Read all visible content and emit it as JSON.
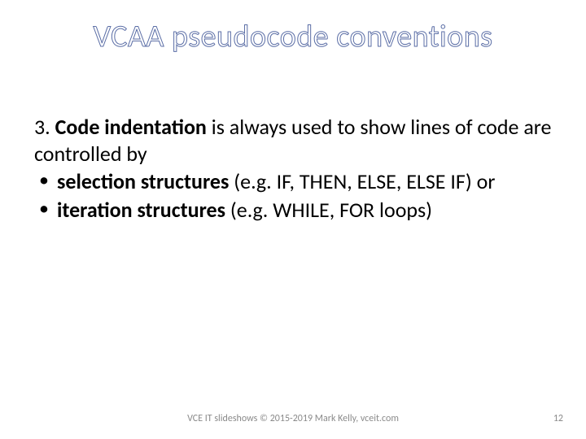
{
  "title": "VCAA pseudocode conventions",
  "intro_num": "3. ",
  "intro_bold": "Code indentation",
  "intro_rest": " is always used to show lines of code are controlled by",
  "bullets": [
    {
      "bold": "selection structures",
      "rest": " (e.g. IF, THEN, ELSE, ELSE IF) or"
    },
    {
      "bold": "iteration structures",
      "rest": " (e.g. WHILE, FOR loops)"
    }
  ],
  "footer": "VCE IT slideshows © 2015-2019 Mark Kelly, vceit.com",
  "page": "12"
}
